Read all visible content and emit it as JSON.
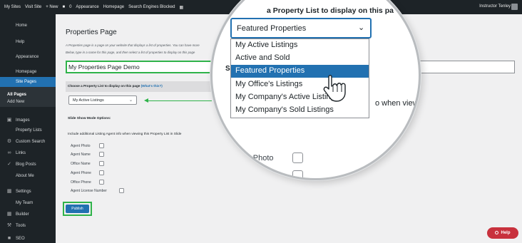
{
  "admin_bar": {
    "my_sites": "My Sites",
    "visit_site": "Visit Site",
    "new": "+ New",
    "comments": "0",
    "appearance": "Appearance",
    "homepage": "Homepage",
    "search_engines": "Search Engines Blocked",
    "user": "Instructor Tenley"
  },
  "sidebar": {
    "items": [
      {
        "label": "Home"
      },
      {
        "label": "Help"
      },
      {
        "label": "Appearance"
      },
      {
        "label": "Homepage"
      },
      {
        "label": "Site Pages"
      },
      {
        "label": "All Pages"
      },
      {
        "label": "Add New"
      },
      {
        "label": "Images"
      },
      {
        "label": "Property Lists"
      },
      {
        "label": "Custom Search"
      },
      {
        "label": "Links"
      },
      {
        "label": "Blog Posts"
      },
      {
        "label": "About Me"
      },
      {
        "label": "Settings"
      },
      {
        "label": "My Team"
      },
      {
        "label": "Builder"
      },
      {
        "label": "Tools"
      },
      {
        "label": "SEO"
      }
    ]
  },
  "main": {
    "title": "Properties Page",
    "description_1": "A Properties page is a page on your website that displays a list of properties. You can have more",
    "description_2": "Below, type in a name for this page, and then select a list of properties to display on this page",
    "page_name_value": "My Properties Page Demo",
    "choose_label": "Choose a Property List to display on this page",
    "whats_this": "(What's this?)",
    "list_select_value": "My Active Listings",
    "slideshow_label": "Slide Show Mode Options:",
    "include_label": "Include additional Listing Agent info when viewing this Property List in Slide",
    "agent_fields": [
      "Agent Photo",
      "Agent Name",
      "Office Name",
      "Agent Phone",
      "Office Phone",
      "Agent License Number"
    ],
    "publish_label": "Publish"
  },
  "zoom": {
    "heading_fragment": "a Property List to display on this pa",
    "selected_value": "Featured Properties",
    "options": [
      "My Active Listings",
      "Active and Sold",
      "Featured Properties",
      "My Office's Listings",
      "My Company's Active Listings",
      "My Company's Sold Listings"
    ],
    "highlighted_index": 2,
    "section_fragment": "S",
    "when_view_fragment": "o when view",
    "agent_photo": "Agent Photo",
    "agent_name_fragment": "ent Name",
    "third_fragment": "e"
  },
  "help": {
    "label": "Help"
  },
  "colors": {
    "admin_dark": "#1d2327",
    "wp_blue": "#2271b1",
    "highlight_green": "#2fb34a",
    "help_red": "#c8313d"
  }
}
